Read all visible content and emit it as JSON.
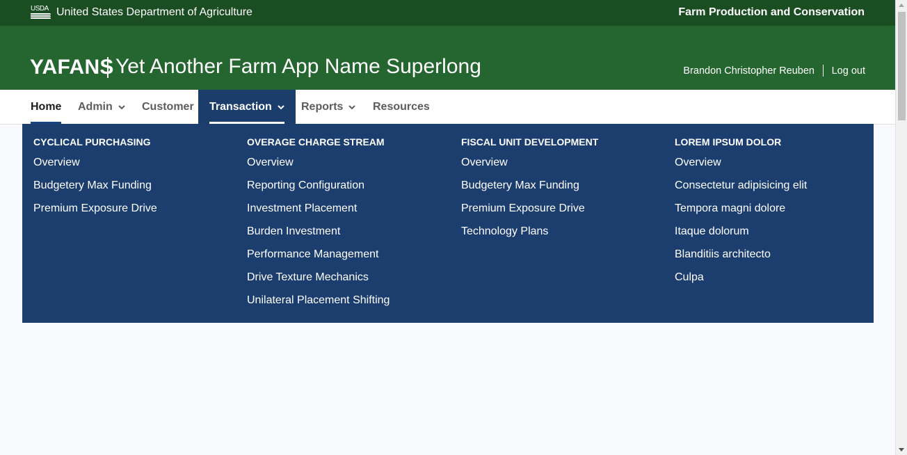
{
  "topbar": {
    "logo_text": "USDA",
    "department": "United States Department of Agriculture",
    "agency": "Farm Production and Conservation"
  },
  "header": {
    "app_abbr": "YAFANS",
    "app_name": "Yet Another Farm App Name Superlong",
    "user_name": "Brandon Christopher Reuben",
    "logout_label": "Log out"
  },
  "nav": {
    "items": [
      {
        "label": "Home"
      },
      {
        "label": "Admin"
      },
      {
        "label": "Customer"
      },
      {
        "label": "Transaction"
      },
      {
        "label": "Reports"
      },
      {
        "label": "Resources"
      }
    ]
  },
  "megamenu": {
    "columns": [
      {
        "heading": "Cyclical Purchasing",
        "links": [
          "Overview",
          "Budgetery Max Funding",
          "Premium Exposure Drive"
        ]
      },
      {
        "heading": "Overage Charge Stream",
        "links": [
          "Overview",
          "Reporting Configuration",
          "Investment Placement",
          "Burden Investment",
          "Performance Management",
          "Drive Texture Mechanics",
          "Unilateral Placement Shifting"
        ]
      },
      {
        "heading": "Fiscal Unit Development",
        "links": [
          "Overview",
          "Budgetery Max Funding",
          "Premium Exposure Drive",
          "Technology Plans"
        ]
      },
      {
        "heading": "Lorem Ipsum Dolor",
        "links": [
          "Overview",
          "Consectetur adipisicing elit",
          "Tempora magni dolore",
          "Itaque dolorum",
          "Blanditiis architecto",
          "Culpa"
        ]
      }
    ]
  },
  "colors": {
    "topbar": "#1b4d23",
    "header": "#246530",
    "megamenu": "#1c3e6e",
    "active_tab": "#1a3d6b"
  }
}
